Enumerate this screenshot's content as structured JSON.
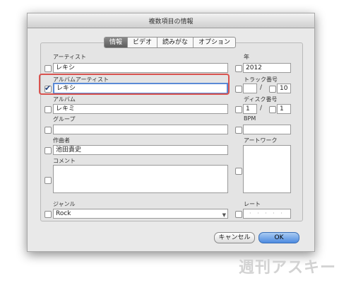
{
  "window": {
    "title": "複数項目の情報"
  },
  "tabs": [
    {
      "label": "情報"
    },
    {
      "label": "ビデオ"
    },
    {
      "label": "読みがな"
    },
    {
      "label": "オプション"
    }
  ],
  "fields": {
    "artist": {
      "label": "アーティスト",
      "value": "レキシ"
    },
    "album_artist": {
      "label": "アルバムアーティスト",
      "value": "レキシ"
    },
    "album": {
      "label": "アルバム",
      "value": "レキミ"
    },
    "grouping": {
      "label": "グループ",
      "value": ""
    },
    "composer": {
      "label": "作曲者",
      "value": "池田貴史"
    },
    "comments": {
      "label": "コメント",
      "value": ""
    },
    "genre": {
      "label": "ジャンル",
      "value": "Rock"
    },
    "year": {
      "label": "年",
      "value": "2012"
    },
    "track": {
      "label": "トラック番号",
      "number": "",
      "slash": "/",
      "total": "10"
    },
    "disc": {
      "label": "ディスク番号",
      "number": "1",
      "slash": "/",
      "total": "1"
    },
    "bpm": {
      "label": "BPM",
      "value": ""
    },
    "artwork": {
      "label": "アートワーク"
    },
    "rating": {
      "label": "レート",
      "value": "· · · · ·"
    }
  },
  "buttons": {
    "cancel": "キャンセル",
    "ok": "OK"
  },
  "watermark": "週刊アスキー"
}
